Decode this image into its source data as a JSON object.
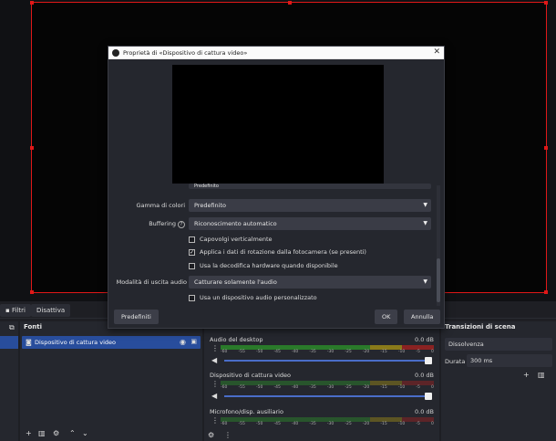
{
  "toolbar": {
    "filters_label": "Filtri",
    "disable_label": "Disattiva"
  },
  "sources": {
    "title": "Fonti",
    "items": [
      {
        "label": "Dispositivo di cattura video"
      }
    ]
  },
  "mixer": {
    "tracks": [
      {
        "name": "Audio del desktop",
        "db": "0.0 dB"
      },
      {
        "name": "Dispositivo di cattura video",
        "db": "0.0 dB"
      },
      {
        "name": "Microfono/disp. ausiliario",
        "db": "0.0 dB"
      }
    ],
    "ticks": [
      "-60",
      "-55",
      "-50",
      "-45",
      "-40",
      "-35",
      "-30",
      "-25",
      "-20",
      "-15",
      "-10",
      "-5",
      "0"
    ]
  },
  "transitions": {
    "title": "Transizioni di scena",
    "selected": "Dissolvenza",
    "duration_label": "Durata",
    "duration_value": "300 ms"
  },
  "dialog": {
    "title": "Proprietà di «Dispositivo di cattura video»",
    "color_range_label": "Gamma di colori",
    "color_range_value": "Predefinito",
    "buffering_label": "Buffering",
    "buffering_value": "Riconoscimento automatico",
    "flip_label": "Capovolgi verticalmente",
    "rotation_label": "Applica i dati di rotazione dalla fotocamera (se presenti)",
    "hw_label": "Usa la decodifica hardware quando disponibile",
    "audio_mode_label": "Modalità di uscita audio",
    "audio_mode_value": "Catturare solamente l'audio",
    "custom_audio_label": "Usa un dispositivo audio personalizzato",
    "defaults_button": "Predefiniti",
    "ok_button": "OK",
    "cancel_button": "Annulla",
    "hidden_value": "Predefinito"
  },
  "colors": {
    "selection": "#284d9c",
    "bounding_box": "#e01818"
  }
}
